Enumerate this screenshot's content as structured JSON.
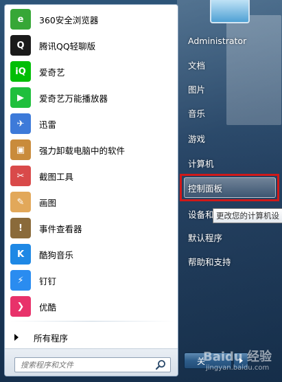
{
  "programs": [
    {
      "label": "360安全浏览器",
      "icon": "360-browser-icon",
      "color": "#37a737",
      "glyph": "e"
    },
    {
      "label": "腾讯QQ轻聊版",
      "icon": "qq-penguin-icon",
      "color": "#1a1a1a",
      "glyph": "Q"
    },
    {
      "label": "爱奇艺",
      "icon": "iqiyi-icon",
      "color": "#00be06",
      "glyph": "iQ"
    },
    {
      "label": "爱奇艺万能播放器",
      "icon": "iqiyi-player-icon",
      "color": "#1fbf3c",
      "glyph": "▶"
    },
    {
      "label": "迅雷",
      "icon": "xunlei-bird-icon",
      "color": "#3d7ad9",
      "glyph": "✈"
    },
    {
      "label": "强力卸载电脑中的软件",
      "icon": "uninstall-box-icon",
      "color": "#c98b3b",
      "glyph": "▣"
    },
    {
      "label": "截图工具",
      "icon": "scissors-icon",
      "color": "#d94a4a",
      "glyph": "✂"
    },
    {
      "label": "画图",
      "icon": "paint-palette-icon",
      "color": "#e2a85a",
      "glyph": "✎"
    },
    {
      "label": "事件查看器",
      "icon": "event-viewer-icon",
      "color": "#8a6a3a",
      "glyph": "!"
    },
    {
      "label": "酷狗音乐",
      "icon": "kugou-icon",
      "color": "#1e88e5",
      "glyph": "K"
    },
    {
      "label": "钉钉",
      "icon": "dingtalk-icon",
      "color": "#2a8cf0",
      "glyph": "⚡"
    },
    {
      "label": "优酷",
      "icon": "youku-icon",
      "color": "#e8326a",
      "glyph": "❯"
    }
  ],
  "all_programs": "所有程序",
  "search": {
    "placeholder": "搜索程序和文件"
  },
  "right": {
    "user": "Administrator",
    "documents": "文档",
    "pictures": "图片",
    "music": "音乐",
    "games": "游戏",
    "computer": "计算机",
    "control_panel": "控制面板",
    "devices": "设备和",
    "default_programs": "默认程序",
    "help": "帮助和支持"
  },
  "tooltip": "更改您的计算机设",
  "shutdown": "关",
  "watermark": {
    "brand": "Baidu 经验",
    "url": "jingyan.baidu.com"
  }
}
